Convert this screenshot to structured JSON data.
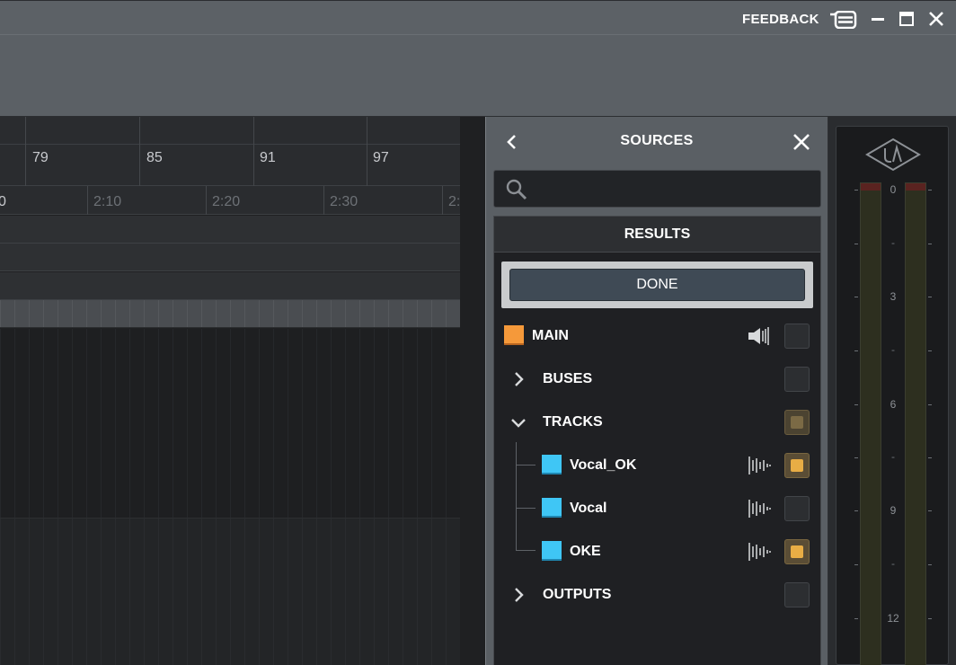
{
  "titlebar": {
    "feedback_label": "FEEDBACK"
  },
  "timeline": {
    "bar_numbers": [
      "79",
      "85",
      "91",
      "97"
    ],
    "time_labels": [
      "0",
      "2:10",
      "2:20",
      "2:30",
      "2:"
    ]
  },
  "sources": {
    "title": "SOURCES",
    "search": {
      "value": "",
      "placeholder": ""
    },
    "results_header": "RESULTS",
    "done_label": "DONE",
    "main": {
      "label": "MAIN",
      "color": "#f5993a",
      "checked": false
    },
    "buses": {
      "label": "BUSES",
      "expanded": false,
      "checked": false
    },
    "tracks": {
      "label": "TRACKS",
      "expanded": true,
      "state": "partial",
      "items": [
        {
          "label": "Vocal_OK",
          "color": "#3fc6f5",
          "checked": true
        },
        {
          "label": "Vocal",
          "color": "#3fc6f5",
          "checked": false
        },
        {
          "label": "OKE",
          "color": "#3fc6f5",
          "checked": true
        }
      ]
    },
    "outputs": {
      "label": "OUTPUTS",
      "expanded": false,
      "checked": false
    }
  },
  "meter": {
    "scale": [
      "0",
      "3",
      "6",
      "9",
      "12"
    ]
  },
  "colors": {
    "accent_checkbox": "#e8ad45",
    "track_color": "#3fc6f5",
    "main_color": "#f5993a"
  }
}
